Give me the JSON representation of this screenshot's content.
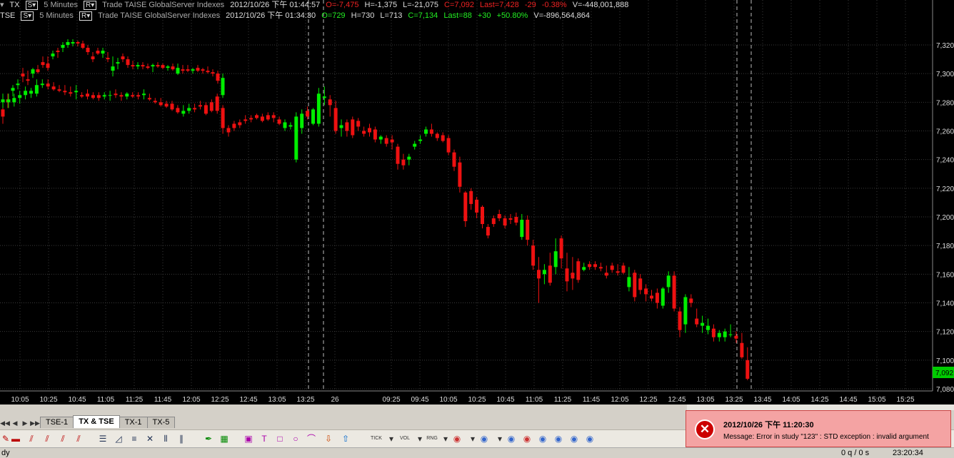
{
  "header1": {
    "symbol": "TX",
    "s_button": "S▾",
    "interval": "5 Minutes",
    "r_button": "R▾",
    "source": "Trade TAISE GlobalServer Indexes",
    "datetime": "2012/10/26 下午 01:44:57",
    "open": "O=-7,475",
    "high": "H=-1,375",
    "low": "L=-21,075",
    "close": "C=7,092",
    "last": "Last=7,428",
    "change": "-29",
    "change_pct": "-0.38%",
    "volume": "V=-448,001,888"
  },
  "header2": {
    "symbol": "TSE",
    "s_button": "S▾",
    "interval": "5 Minutes",
    "r_button": "R▾",
    "source": "Trade TAISE GlobalServer Indexes",
    "datetime": "2012/10/26 下午 01:34:30",
    "open": "O=729",
    "high": "H=730",
    "low": "L=713",
    "close": "C=7,134",
    "last": "Last=88",
    "change": "+30",
    "change_pct": "+50.80%",
    "volume": "V=-896,564,864"
  },
  "colors": {
    "up": "#00ee00",
    "down": "#ee1111",
    "grid": "#3a3a3a",
    "price_tag_bg": "#00cc00"
  },
  "price_tag": "7,092",
  "chart_data": {
    "type": "candlestick",
    "y_ticks": [
      "7,320",
      "7,300",
      "7,280",
      "7,260",
      "7,240",
      "7,220",
      "7,200",
      "7,180",
      "7,160",
      "7,140",
      "7,120",
      "7,100",
      "7,080"
    ],
    "ylim": [
      7080,
      7320
    ],
    "x_ticks": [
      "10:05",
      "10:25",
      "10:45",
      "11:05",
      "11:25",
      "11:45",
      "12:05",
      "12:25",
      "12:45",
      "13:05",
      "13:25",
      "26",
      "09:25",
      "09:45",
      "10:05",
      "10:25",
      "10:45",
      "11:05",
      "11:25",
      "11:45",
      "12:05",
      "12:25",
      "12:45",
      "13:05",
      "13:25",
      "13:45",
      "14:05",
      "14:25",
      "14:45",
      "15:05",
      "15:25"
    ],
    "series": [
      {
        "name": "TX",
        "ohlc": [
          [
            7275,
            7278,
            7265,
            7270
          ],
          [
            7282,
            7286,
            7276,
            7280
          ],
          [
            7288,
            7292,
            7284,
            7290
          ],
          [
            7292,
            7296,
            7289,
            7293
          ],
          [
            7300,
            7304,
            7294,
            7298
          ],
          [
            7296,
            7302,
            7292,
            7295
          ],
          [
            7300,
            7304,
            7297,
            7303
          ],
          [
            7303,
            7306,
            7300,
            7301
          ],
          [
            7308,
            7312,
            7304,
            7306
          ],
          [
            7307,
            7312,
            7302,
            7304
          ],
          [
            7312,
            7316,
            7310,
            7314
          ],
          [
            7316,
            7318,
            7311,
            7315
          ],
          [
            7318,
            7322,
            7315,
            7320
          ],
          [
            7320,
            7324,
            7318,
            7322
          ],
          [
            7321,
            7324,
            7319,
            7322
          ],
          [
            7322,
            7323,
            7319,
            7321
          ],
          [
            7321,
            7323,
            7317,
            7318
          ],
          [
            7318,
            7320,
            7313,
            7315
          ],
          [
            7312,
            7315,
            7308,
            7310
          ],
          [
            7316,
            7318,
            7313,
            7314
          ],
          [
            7314,
            7318,
            7311,
            7316
          ],
          [
            7311,
            7315,
            7308,
            7310
          ],
          [
            7302,
            7312,
            7298,
            7305
          ],
          [
            7307,
            7311,
            7303,
            7308
          ],
          [
            7312,
            7314,
            7308,
            7310
          ],
          [
            7310,
            7312,
            7304,
            7306
          ],
          [
            7306,
            7309,
            7303,
            7305
          ],
          [
            7305,
            7308,
            7303,
            7306
          ],
          [
            7306,
            7308,
            7303,
            7305
          ],
          [
            7305,
            7307,
            7303,
            7304
          ],
          [
            7305,
            7307,
            7301,
            7306
          ],
          [
            7306,
            7308,
            7304,
            7305
          ],
          [
            7306,
            7307,
            7303,
            7304
          ],
          [
            7304,
            7306,
            7302,
            7305
          ],
          [
            7305,
            7307,
            7302,
            7303
          ],
          [
            7300,
            7307,
            7299,
            7304
          ],
          [
            7303,
            7306,
            7300,
            7302
          ],
          [
            7303,
            7306,
            7301,
            7302
          ],
          [
            7302,
            7304,
            7300,
            7303
          ],
          [
            7304,
            7306,
            7301,
            7302
          ],
          [
            7303,
            7304,
            7300,
            7302
          ],
          [
            7302,
            7305,
            7300,
            7301
          ],
          [
            7301,
            7303,
            7298,
            7300
          ],
          [
            7300,
            7302,
            7293,
            7295
          ],
          [
            7285,
            7300,
            7283,
            7297
          ]
        ]
      },
      {
        "name": "TSE",
        "ohlc": [
          [
            7280,
            7286,
            7276,
            7282
          ],
          [
            7280,
            7286,
            7276,
            7282
          ],
          [
            7280,
            7286,
            7277,
            7283
          ],
          [
            7283,
            7288,
            7279,
            7285
          ],
          [
            7285,
            7291,
            7282,
            7288
          ],
          [
            7286,
            7290,
            7283,
            7288
          ],
          [
            7286,
            7296,
            7284,
            7292
          ],
          [
            7292,
            7296,
            7290,
            7293
          ],
          [
            7293,
            7296,
            7289,
            7291
          ],
          [
            7291,
            7294,
            7288,
            7289
          ],
          [
            7289,
            7292,
            7287,
            7288
          ],
          [
            7288,
            7292,
            7285,
            7287
          ],
          [
            7287,
            7291,
            7284,
            7286
          ],
          [
            7287,
            7292,
            7282,
            7288
          ],
          [
            7285,
            7287,
            7283,
            7284
          ],
          [
            7286,
            7289,
            7282,
            7284
          ],
          [
            7285,
            7287,
            7282,
            7283
          ],
          [
            7285,
            7287,
            7281,
            7283
          ],
          [
            7284,
            7287,
            7282,
            7285
          ],
          [
            7285,
            7288,
            7281,
            7285
          ],
          [
            7286,
            7289,
            7283,
            7285
          ],
          [
            7285,
            7287,
            7281,
            7284
          ],
          [
            7284,
            7287,
            7282,
            7286
          ],
          [
            7285,
            7287,
            7283,
            7284
          ],
          [
            7285,
            7287,
            7282,
            7284
          ],
          [
            7285,
            7289,
            7282,
            7286
          ],
          [
            7283,
            7286,
            7281,
            7282
          ],
          [
            7281,
            7283,
            7279,
            7280
          ],
          [
            7280,
            7283,
            7277,
            7278
          ],
          [
            7279,
            7281,
            7276,
            7277
          ],
          [
            7279,
            7281,
            7274,
            7275
          ],
          [
            7276,
            7278,
            7272,
            7273
          ],
          [
            7272,
            7278,
            7270,
            7274
          ],
          [
            7274,
            7279,
            7272,
            7276
          ],
          [
            7276,
            7279,
            7273,
            7275
          ],
          [
            7278,
            7281,
            7275,
            7277
          ],
          [
            7278,
            7280,
            7271,
            7272
          ],
          [
            7280,
            7282,
            7273,
            7274
          ],
          [
            7284,
            7286,
            7272,
            7274
          ],
          [
            7276,
            7278,
            7258,
            7262
          ],
          [
            7262,
            7264,
            7256,
            7259
          ],
          [
            7265,
            7267,
            7260,
            7262
          ],
          [
            7266,
            7268,
            7262,
            7264
          ],
          [
            7268,
            7271,
            7265,
            7267
          ],
          [
            7269,
            7271,
            7266,
            7268
          ],
          [
            7271,
            7272,
            7268,
            7269
          ],
          [
            7270,
            7272,
            7266,
            7267
          ],
          [
            7271,
            7273,
            7267,
            7268
          ],
          [
            7271,
            7273,
            7266,
            7269
          ],
          [
            7268,
            7270,
            7264,
            7265
          ],
          [
            7262,
            7268,
            7260,
            7266
          ],
          [
            7263,
            7266,
            7261,
            7264
          ],
          [
            7240,
            7273,
            7238,
            7270
          ],
          [
            7262,
            7275,
            7258,
            7272
          ],
          [
            7274,
            7277,
            7268,
            7270
          ],
          [
            7265,
            7276,
            7264,
            7275
          ],
          [
            7265,
            7290,
            7263,
            7286
          ],
          [
            7283,
            7291,
            7278,
            7284
          ],
          [
            7282,
            7285,
            7270,
            7278
          ],
          [
            7276,
            7281,
            7258,
            7260
          ],
          [
            7262,
            7268,
            7256,
            7264
          ],
          [
            7266,
            7268,
            7256,
            7260
          ],
          [
            7268,
            7270,
            7255,
            7257
          ],
          [
            7267,
            7269,
            7260,
            7263
          ],
          [
            7260,
            7263,
            7256,
            7258
          ],
          [
            7262,
            7265,
            7256,
            7259
          ],
          [
            7261,
            7263,
            7252,
            7254
          ],
          [
            7254,
            7257,
            7251,
            7256
          ],
          [
            7255,
            7257,
            7249,
            7251
          ],
          [
            7254,
            7257,
            7247,
            7252
          ],
          [
            7249,
            7251,
            7233,
            7237
          ],
          [
            7240,
            7244,
            7233,
            7236
          ],
          [
            7240,
            7244,
            7236,
            7242
          ],
          [
            7249,
            7253,
            7247,
            7251
          ],
          [
            7253,
            7257,
            7251,
            7254
          ],
          [
            7258,
            7263,
            7256,
            7261
          ],
          [
            7261,
            7265,
            7256,
            7258
          ],
          [
            7258,
            7259,
            7253,
            7255
          ],
          [
            7257,
            7259,
            7252,
            7253
          ],
          [
            7255,
            7257,
            7243,
            7245
          ],
          [
            7245,
            7247,
            7232,
            7235
          ],
          [
            7238,
            7242,
            7217,
            7221
          ],
          [
            7217,
            7218,
            7193,
            7197
          ],
          [
            7218,
            7220,
            7205,
            7209
          ],
          [
            7212,
            7214,
            7199,
            7203
          ],
          [
            7207,
            7208,
            7192,
            7195
          ],
          [
            7193,
            7195,
            7185,
            7187
          ],
          [
            7199,
            7201,
            7193,
            7195
          ],
          [
            7202,
            7205,
            7197,
            7199
          ],
          [
            7199,
            7201,
            7192,
            7194
          ],
          [
            7199,
            7202,
            7195,
            7198
          ],
          [
            7200,
            7203,
            7194,
            7196
          ],
          [
            7186,
            7202,
            7184,
            7198
          ],
          [
            7198,
            7201,
            7180,
            7184
          ],
          [
            7180,
            7184,
            7163,
            7166
          ],
          [
            7163,
            7172,
            7140,
            7157
          ],
          [
            7160,
            7167,
            7153,
            7163
          ],
          [
            7166,
            7175,
            7152,
            7154
          ],
          [
            7165,
            7185,
            7160,
            7176
          ],
          [
            7185,
            7187,
            7164,
            7171
          ],
          [
            7164,
            7175,
            7148,
            7155
          ],
          [
            7161,
            7172,
            7149,
            7157
          ],
          [
            7169,
            7171,
            7154,
            7156
          ],
          [
            7163,
            7168,
            7162,
            7165
          ],
          [
            7167,
            7169,
            7163,
            7165
          ],
          [
            7167,
            7169,
            7163,
            7165
          ],
          [
            7165,
            7168,
            7162,
            7164
          ],
          [
            7161,
            7166,
            7157,
            7159
          ],
          [
            7166,
            7168,
            7161,
            7163
          ],
          [
            7162,
            7167,
            7159,
            7161
          ],
          [
            7166,
            7168,
            7160,
            7161
          ],
          [
            7151,
            7165,
            7148,
            7158
          ],
          [
            7161,
            7163,
            7141,
            7144
          ],
          [
            7157,
            7160,
            7146,
            7149
          ],
          [
            7150,
            7153,
            7141,
            7146
          ],
          [
            7145,
            7149,
            7141,
            7143
          ],
          [
            7147,
            7150,
            7136,
            7140
          ],
          [
            7138,
            7151,
            7136,
            7150
          ],
          [
            7151,
            7162,
            7147,
            7159
          ],
          [
            7159,
            7162,
            7134,
            7136
          ],
          [
            7134,
            7137,
            7116,
            7121
          ],
          [
            7125,
            7146,
            7119,
            7144
          ],
          [
            7143,
            7146,
            7137,
            7140
          ],
          [
            7129,
            7136,
            7123,
            7125
          ],
          [
            7124,
            7131,
            7119,
            7126
          ],
          [
            7121,
            7129,
            7118,
            7124
          ],
          [
            7122,
            7125,
            7113,
            7116
          ],
          [
            7116,
            7121,
            7113,
            7119
          ],
          [
            7116,
            7122,
            7113,
            7120
          ],
          [
            7118,
            7125,
            7116,
            7118
          ],
          [
            7117,
            7120,
            7112,
            7115
          ],
          [
            7112,
            7119,
            7101,
            7102
          ],
          [
            7100,
            7109,
            7086,
            7087
          ]
        ]
      }
    ]
  },
  "tabs": {
    "nav": [
      "◀◀",
      "◀",
      "▶",
      "▶▶"
    ],
    "items": [
      {
        "label": "TSE-1"
      },
      {
        "label": "TX & TSE"
      },
      {
        "label": "TX-1"
      },
      {
        "label": "TX-5"
      }
    ]
  },
  "toolbar": {
    "tick_label": "TICK",
    "vol_label": "VOL",
    "rng_label": "RNG"
  },
  "popup": {
    "title": "2012/10/26 下午 11:20:30",
    "message": "Message: Error in study \"123\" : STD exception : invalid argument",
    "icon": "error-icon"
  },
  "statusbar": {
    "left": "dy",
    "counts": "0 q / 0 s",
    "time": "23:20:34"
  }
}
